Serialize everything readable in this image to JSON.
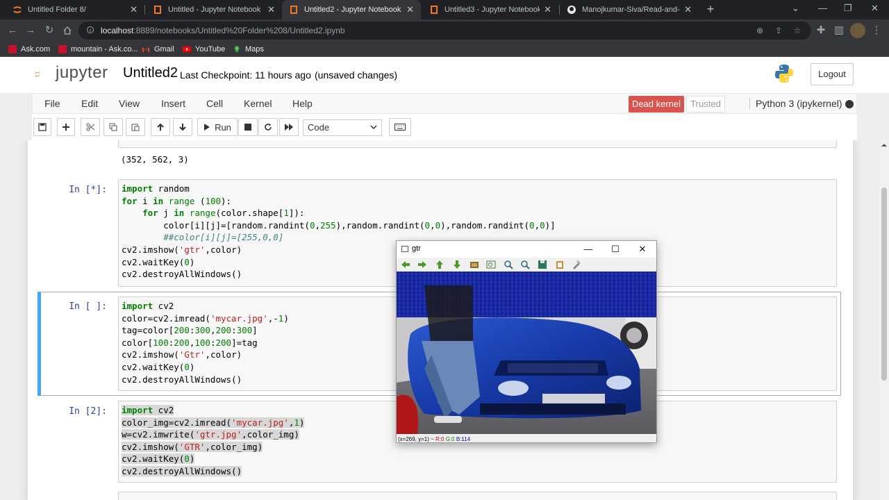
{
  "browser": {
    "tabs": [
      {
        "label": "Untitled Folder 8/",
        "active": false
      },
      {
        "label": "Untitled - Jupyter Notebook",
        "active": false
      },
      {
        "label": "Untitled2 - Jupyter Notebook",
        "active": true
      },
      {
        "label": "Untitled3 - Jupyter Notebook",
        "active": false
      },
      {
        "label": "Manojkumar-Siva/Read-and-Wr",
        "active": false
      }
    ],
    "url_host": "localhost",
    "url_path": ":8889/notebooks/Untitled%20Folder%208/Untitled2.ipynb",
    "bookmarks": [
      {
        "label": "Ask.com"
      },
      {
        "label": "mountain - Ask.co..."
      },
      {
        "label": "Gmail"
      },
      {
        "label": "YouTube"
      },
      {
        "label": "Maps"
      }
    ]
  },
  "jupyter": {
    "logo_text": "jupyter",
    "notebook_name": "Untitled2",
    "checkpoint": "Last Checkpoint: 11 hours ago",
    "unsaved": "(unsaved changes)",
    "logout_label": "Logout",
    "menu": [
      "File",
      "Edit",
      "View",
      "Insert",
      "Cell",
      "Kernel",
      "Help"
    ],
    "dead_kernel": "Dead kernel",
    "trusted": "Trusted",
    "kernel_name": "Python 3 (ipykernel)",
    "run_label": "Run",
    "cell_type": "Code"
  },
  "cells": {
    "output0": "(352, 562, 3)",
    "cell1_prompt": "In [*]:",
    "cell2_prompt": "In [ ]:",
    "cell3_prompt": "In [2]:"
  },
  "cvwindow": {
    "title": "gtr",
    "status_coords": "(x=269, y=1) ~",
    "status_r": "R:0",
    "status_g": "G:0",
    "status_b": "B:114"
  },
  "colors": {
    "jupyter_orange": "#f37726",
    "selected_border": "#42a5f5",
    "dead_kernel": "#d9534f",
    "keyword": "#008000",
    "string": "#ba2121",
    "prompt": "#303f9f"
  }
}
